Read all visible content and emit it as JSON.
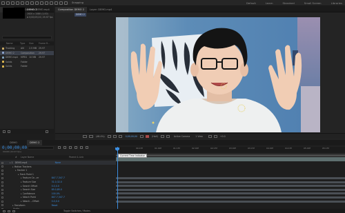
{
  "topbar": {
    "workspaces": [
      "Default",
      "Learn",
      "Standard",
      "Small Screen",
      "Libraries"
    ],
    "snapping_label": "Snapping"
  },
  "project": {
    "tabs": [
      "Project",
      "Effect Controls DEMO.mp4"
    ],
    "comp_name": "DEMO 2",
    "comp_info1": "1920 x 1080 (1.00)",
    "comp_info2": "Δ 0;00;05;20, 29.97 fps",
    "columns": [
      "Name",
      "Type",
      "Size",
      "Frame R..."
    ],
    "items": [
      {
        "name": "Tracking",
        "type": "AVI",
        "size": "2.5 MB",
        "rate": "29.97"
      },
      {
        "name": "DEMO 2",
        "type": "Composition",
        "size": "",
        "rate": "29.97"
      },
      {
        "name": "DEMO.mp4",
        "type": "MPEG",
        "size": "10 MB",
        "rate": "29.97"
      },
      {
        "name": "Solids",
        "type": "Folder",
        "size": "",
        "rate": ""
      },
      {
        "name": "Solids",
        "type": "Folder",
        "size": "",
        "rate": ""
      }
    ]
  },
  "viewer": {
    "tabs": [
      "Composition DEMO 2",
      "Layer: DEMO.mp4"
    ],
    "comp_tab": "DEMO 2",
    "zoom": "(48.4%)",
    "timecode": "0;00;00;00",
    "camera": "Active Camera",
    "views": "1 View",
    "resolution": "(Half)",
    "offset": "+0.0"
  },
  "timeline": {
    "tabs": [
      "DEMO",
      "DEMO 2"
    ],
    "timecode": "0;00;00;00",
    "timecode_sub": "00000 (29.97 fps)",
    "header": [
      "#",
      "Layer Name",
      "Parent & Link"
    ],
    "tooltip": "Current Time Indicator",
    "ruler": [
      "0f",
      "00:15f",
      "01:00f",
      "01:15f",
      "02:00f",
      "02:15f",
      "03:00f",
      "03:15f",
      "04:00f",
      "04:15f",
      "05:00f",
      "05:15f"
    ],
    "layers": [
      {
        "indent": 0,
        "label": "1",
        "name": "DEMO.mp4",
        "value": "None"
      },
      {
        "indent": 1,
        "label": "",
        "name": "Motion Trackers",
        "value": ""
      },
      {
        "indent": 2,
        "label": "",
        "name": "Tracker 1",
        "value": ""
      },
      {
        "indent": 3,
        "label": "",
        "name": "Track Point 1",
        "value": ""
      },
      {
        "indent": 4,
        "label": "",
        "name": "Feature Ce...er",
        "value": "847.7,347.7"
      },
      {
        "indent": 4,
        "label": "",
        "name": "Feature Size",
        "value": "31.0,32.0"
      },
      {
        "indent": 4,
        "label": "",
        "name": "Search Offset",
        "value": "0.0,0.0"
      },
      {
        "indent": 4,
        "label": "",
        "name": "Search Size",
        "value": "85.0,85.0"
      },
      {
        "indent": 4,
        "label": "",
        "name": "Confidence",
        "value": "100.0%"
      },
      {
        "indent": 4,
        "label": "",
        "name": "Attach Point",
        "value": "847.7,347.7"
      },
      {
        "indent": 4,
        "label": "",
        "name": "Attach ...Offset",
        "value": "0.0,0.0"
      },
      {
        "indent": 1,
        "label": "",
        "name": "Transform",
        "value": "Reset"
      },
      {
        "indent": 1,
        "label": "",
        "name": "Audio",
        "value": ""
      }
    ],
    "footer": "Toggle Switches / Modes"
  },
  "colors": {
    "accent": "#3b8ee0",
    "wall": "#5b8fb8",
    "shirt": "#eef0f0"
  }
}
